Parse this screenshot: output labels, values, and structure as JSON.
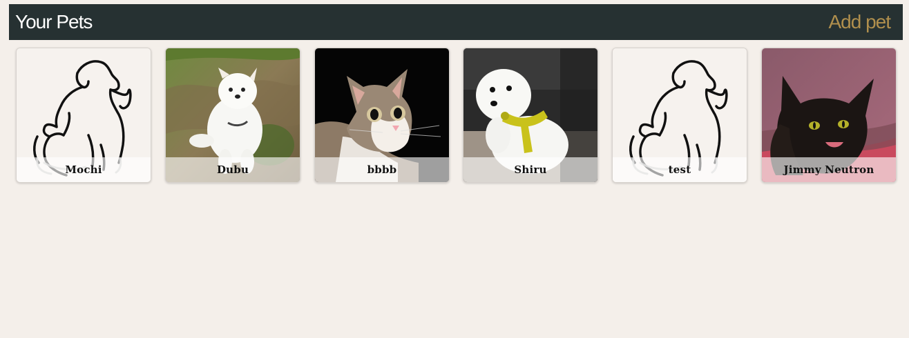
{
  "header": {
    "title": "Your Pets",
    "add_label": "Add pet",
    "bg_color": "#263132",
    "accent_color": "#b08f4d"
  },
  "pets": [
    {
      "name": "Mochi",
      "photo": "placeholder-outline"
    },
    {
      "name": "Dubu",
      "photo": "white-pomeranian-on-grass"
    },
    {
      "name": "bbbb",
      "photo": "tabby-white-cat-on-black"
    },
    {
      "name": "Shiru",
      "photo": "white-bichon-yellow-harness"
    },
    {
      "name": "test",
      "photo": "placeholder-outline"
    },
    {
      "name": "Jimmy Neutron",
      "photo": "black-cat-on-blanket"
    }
  ]
}
